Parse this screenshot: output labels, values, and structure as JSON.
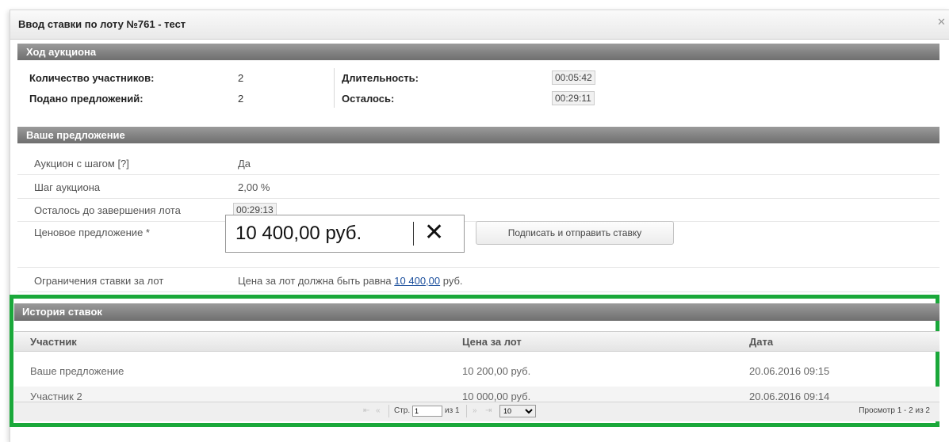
{
  "dialog": {
    "title": "Ввод ставки по лоту №761 - тест",
    "close": "✕"
  },
  "auction_progress": {
    "header": "Ход аукциона",
    "participants_label": "Количество участников:",
    "participants_value": "2",
    "offers_label": "Подано предложений:",
    "offers_value": "2",
    "duration_label": "Длительность:",
    "duration_value": "00:05:42",
    "remaining_label": "Осталось:",
    "remaining_value": "00:29:11"
  },
  "your_offer": {
    "header": "Ваше предложение",
    "step_auction_label": "Аукцион с шагом [?]",
    "step_auction_value": "Да",
    "step_label": "Шаг аукциона",
    "step_value": "2,00 %",
    "left_label": "Осталось до завершения лота",
    "left_value": "00:29:13",
    "price_label": "Ценовое предложение *",
    "price_value": "10 400,00 руб.",
    "sign_button": "Подписать и отправить ставку",
    "limit_label": "Ограничения ставки за лот",
    "limit_prefix": "Цена за лот должна быть равна",
    "limit_amount": "10 400,00",
    "limit_suffix": "руб."
  },
  "history": {
    "header": "История ставок",
    "columns": [
      "Участник",
      "Цена за лот",
      "Дата"
    ],
    "rows": [
      {
        "participant": "Ваше предложение",
        "price": "10 200,00 руб.",
        "date": "20.06.2016 09:15"
      },
      {
        "participant": "Участник 2",
        "price": "10 000,00 руб.",
        "date": "20.06.2016 09:14"
      }
    ],
    "pager": {
      "page_label": "Стр.",
      "page_value": "1",
      "of_label": "из 1",
      "page_size": "10",
      "view_text": "Просмотр 1 - 2 из 2"
    }
  },
  "icons": {
    "first": "⇤",
    "prev": "«",
    "next": "»",
    "last": "⇥",
    "clear": "✕"
  }
}
